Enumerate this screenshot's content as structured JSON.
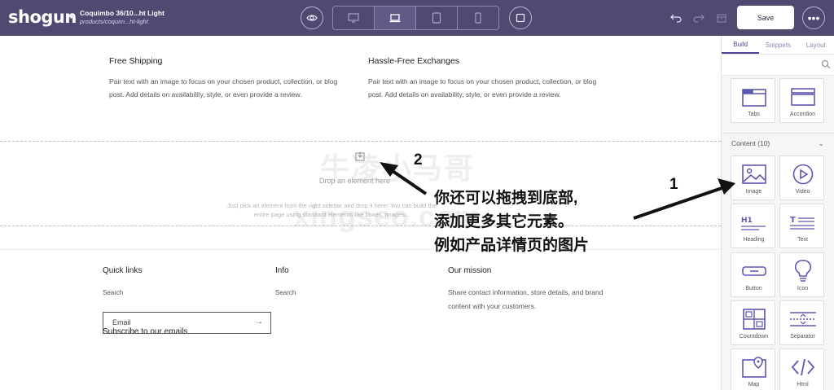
{
  "topbar": {
    "logo": "shogun",
    "page_title": "Coquimbo 36/10...ht Light",
    "page_path": "products/coquim...ht-light",
    "save_label": "Save"
  },
  "canvas": {
    "features": [
      {
        "title": "Free Shipping",
        "text": "Pair text with an image to focus on your chosen product, collection, or blog post. Add details on availability, style, or even provide a review."
      },
      {
        "title": "Hassle-Free Exchanges",
        "text": "Pair text with an image to focus on your chosen product, collection, or blog post. Add details on availability, style, or even provide a review."
      }
    ],
    "dropzone": {
      "title": "Drop an element here",
      "desc": "Just pick an element from the right sidebar and drop it here! You can build the entire page using standard elements like boxes, images..."
    },
    "footer": {
      "quick_links_heading": "Quick links",
      "quick_links_item": "Search",
      "info_heading": "Info",
      "info_item": "Search",
      "mission_heading": "Our mission",
      "mission_text": "Share contact information, store details, and brand content with your customers.",
      "subscribe_heading": "Subscribe to our emails",
      "email_placeholder": "Email"
    }
  },
  "annotations": {
    "num_1": "1",
    "num_2": "2",
    "line_1": "你还可以拖拽到底部,",
    "line_2": "添加更多其它元素。",
    "line_3": "例如产品详情页的图片",
    "watermark_cn": "牛凌小马哥",
    "watermark_en": "xingseo.com"
  },
  "sidebar": {
    "tabs": [
      "Build",
      "Snippets",
      "Layout"
    ],
    "active_tab": "Build",
    "section_title": "Content (10)",
    "top_elements": [
      "Tabs",
      "Accordion"
    ],
    "content_elements": [
      "Image",
      "Video",
      "Heading",
      "Text",
      "Button",
      "Icon",
      "Countdown",
      "Separator",
      "Map",
      "Html"
    ]
  },
  "colors": {
    "topbar": "#4e4a72",
    "accent": "#4b448f",
    "element_icon": "#5e57b3"
  }
}
